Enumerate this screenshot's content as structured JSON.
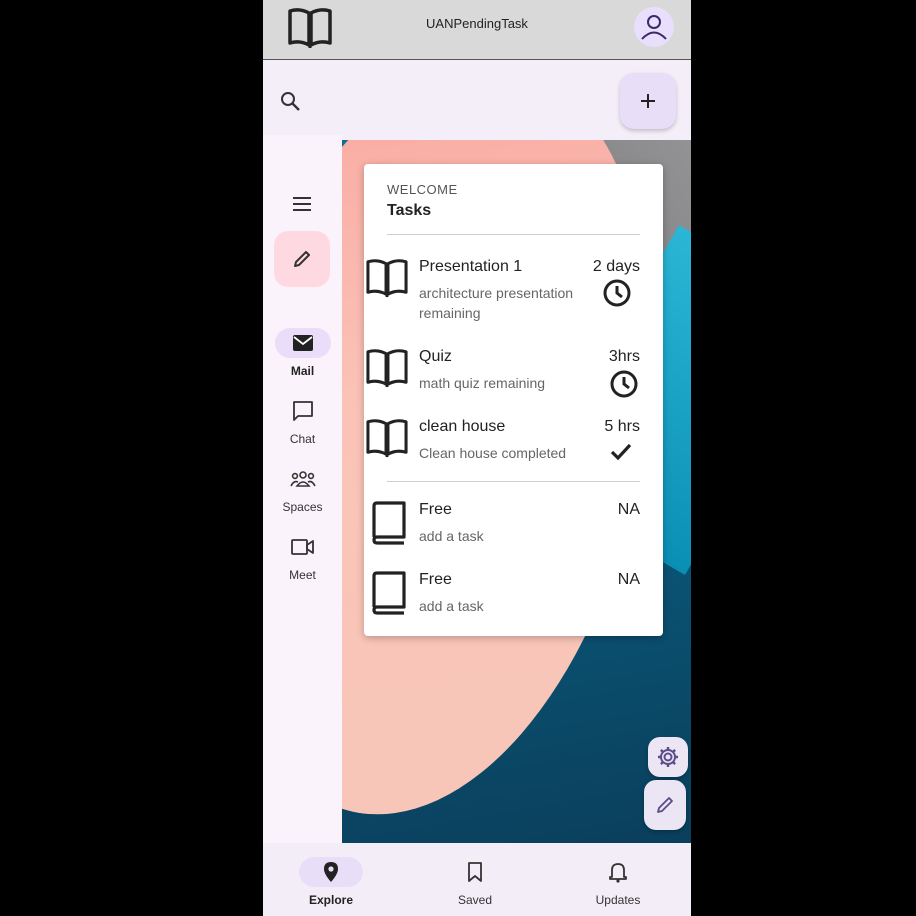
{
  "app": {
    "title": "UANPendingTask"
  },
  "card": {
    "overline": "WELCOME",
    "heading": "Tasks",
    "tasks": [
      {
        "name": "Presentation 1",
        "desc": "architecture presentation remaining",
        "time": "2 days",
        "status_icon": "clock-icon"
      },
      {
        "name": "Quiz",
        "desc": "math quiz remaining",
        "time": "3hrs",
        "status_icon": "clock-icon"
      },
      {
        "name": "clean house",
        "desc": "Clean house completed",
        "time": "5 hrs",
        "status_icon": "check-icon"
      }
    ],
    "free": [
      {
        "name": "Free",
        "desc": "add a task",
        "time": "NA"
      },
      {
        "name": "Free",
        "desc": "add a task",
        "time": "NA"
      }
    ]
  },
  "rail": {
    "items": [
      {
        "label": "Mail",
        "icon": "mail-icon",
        "active": true
      },
      {
        "label": "Chat",
        "icon": "chat-icon",
        "active": false
      },
      {
        "label": "Spaces",
        "icon": "spaces-icon",
        "active": false
      },
      {
        "label": "Meet",
        "icon": "meet-icon",
        "active": false
      }
    ]
  },
  "bottom_nav": {
    "items": [
      {
        "label": "Explore",
        "icon": "location-pin-icon",
        "active": true
      },
      {
        "label": "Saved",
        "icon": "bookmark-icon",
        "active": false
      },
      {
        "label": "Updates",
        "icon": "bell-icon",
        "active": false
      }
    ]
  },
  "colors": {
    "accent": "#e8def8",
    "compose": "#ffd9e2",
    "rail": "#fbf3fb"
  }
}
